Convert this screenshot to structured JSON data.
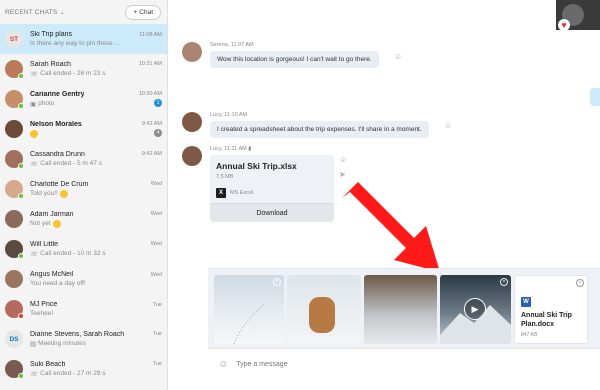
{
  "sidebar": {
    "title": "RECENT CHATS",
    "new_chat_label": "Chat",
    "items": [
      {
        "initials": "ST",
        "name": "Ski Trip plans",
        "time": "11:08 AM",
        "sub": "Is there any way to pin these ..."
      },
      {
        "name": "Sarah Roach",
        "time": "10:31 AM",
        "sub": "Call ended - 26 m 23 s"
      },
      {
        "name": "Carianne Gentry",
        "time": "10:30 AM",
        "sub": "photo",
        "badge": "1"
      },
      {
        "name": "Nelson Morales",
        "time": "9:42 AM",
        "badge": "4"
      },
      {
        "name": "Cassandra Drunn",
        "time": "9:42 AM",
        "sub": "Call ended - 5 m 47 s"
      },
      {
        "name": "Charlotte De Crum",
        "time": "Wed",
        "sub": "Told you!!"
      },
      {
        "name": "Adam Jarman",
        "time": "Wed",
        "sub": "Not yet"
      },
      {
        "name": "Will Little",
        "time": "Wed",
        "sub": "Call ended - 10 m 32 s"
      },
      {
        "name": "Angus McNeil",
        "time": "Wed",
        "sub": "You need a day off!"
      },
      {
        "name": "MJ Price",
        "time": "Tue",
        "sub": "Teehee!"
      },
      {
        "initials": "DS",
        "name": "Dianne Stevens, Sarah Roach",
        "time": "Tue",
        "sub": "Meeting minutes"
      },
      {
        "name": "Suki Beach",
        "time": "Tue",
        "sub": "Call ended - 27 m 29 s"
      }
    ]
  },
  "messages": [
    {
      "sender": "Serena",
      "time": "11:07 AM",
      "text": "Wow this location is gorgeous! I can't wait to go there."
    },
    {
      "sender": "Lucy",
      "time": "11:10 AM",
      "text": "I created a spreadsheet about the trip expenses. I'll share in a moment."
    },
    {
      "sender": "Lucy",
      "time": "11:11 AM"
    }
  ],
  "file": {
    "name": "Annual Ski Trip.xlsx",
    "size": "7.5 MB",
    "app": "MS Excel",
    "download_label": "Download"
  },
  "tray": {
    "doc_name": "Annual Ski Trip Plan.docx",
    "doc_size": "847 KB"
  },
  "composer": {
    "placeholder": "Type a message"
  },
  "colors": {
    "accent": "#1f8fe0",
    "arrow": "#ff1a1a",
    "active_chat": "#cdeafb"
  }
}
